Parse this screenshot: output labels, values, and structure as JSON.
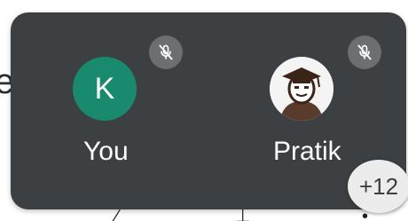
{
  "background": {
    "partial_letter": "e"
  },
  "call_panel": {
    "participants": [
      {
        "initial": "K",
        "name": "You",
        "avatar_color": "#1a8a6e",
        "status_icon": "mic-off-icon"
      },
      {
        "initial": "",
        "name": "Pratik",
        "avatar_style": "graduation-cap-photo",
        "status_icon": "mic-off-icon"
      }
    ],
    "overflow_count": "+12"
  },
  "colors": {
    "panel_bg": "#3c4043",
    "mute_badge_bg": "#6b6f72",
    "overflow_badge_bg": "#ececec",
    "text": "#ffffff"
  }
}
